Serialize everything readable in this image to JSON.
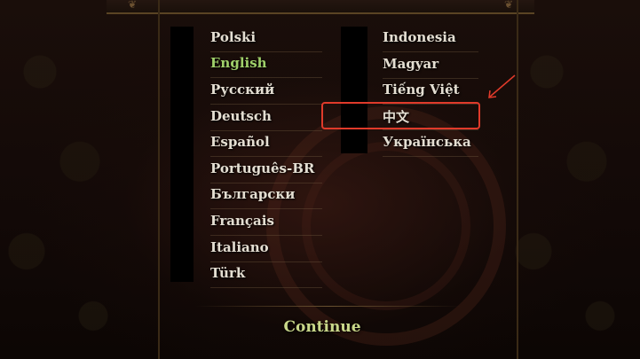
{
  "languages_left": [
    {
      "label": "Polski",
      "selected": false
    },
    {
      "label": "English",
      "selected": true
    },
    {
      "label": "Русский",
      "selected": false
    },
    {
      "label": "Deutsch",
      "selected": false
    },
    {
      "label": "Español",
      "selected": false
    },
    {
      "label": "Português-BR",
      "selected": false
    },
    {
      "label": "Български",
      "selected": false
    },
    {
      "label": "Français",
      "selected": false
    },
    {
      "label": "Italiano",
      "selected": false
    },
    {
      "label": "Türk",
      "selected": false
    }
  ],
  "languages_right": [
    {
      "label": "Indonesia",
      "selected": false
    },
    {
      "label": "Magyar",
      "selected": false
    },
    {
      "label": "Tiếng Việt",
      "selected": false
    },
    {
      "label": "中文",
      "selected": false,
      "highlighted": true
    },
    {
      "label": "Українська",
      "selected": false
    }
  ],
  "continue_label": "Continue",
  "colors": {
    "selected": "#9fd06a",
    "text": "#e4ded2",
    "highlight": "#e03a2a",
    "continue": "#c9d88a"
  }
}
